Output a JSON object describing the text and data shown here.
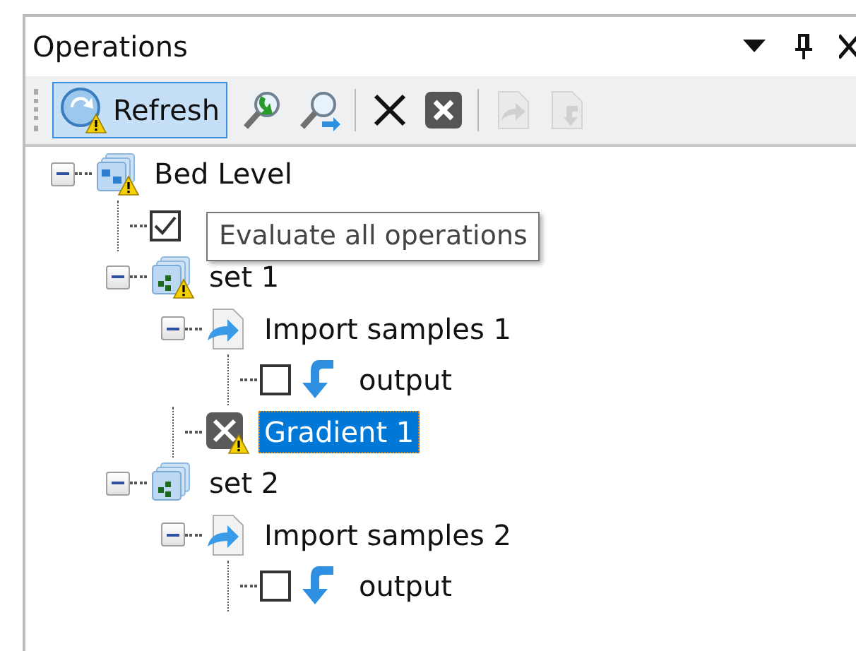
{
  "panel": {
    "title": "Operations"
  },
  "toolbar": [
    {
      "kind": "refresh",
      "label": "Refresh",
      "selected": true,
      "disabled": false
    },
    {
      "kind": "find-next",
      "disabled": false
    },
    {
      "kind": "find-prev",
      "disabled": false
    },
    {
      "kind": "separator"
    },
    {
      "kind": "delete",
      "disabled": false
    },
    {
      "kind": "cancel",
      "disabled": false
    },
    {
      "kind": "separator"
    },
    {
      "kind": "export",
      "disabled": true
    },
    {
      "kind": "import",
      "disabled": true
    }
  ],
  "tree": [
    {
      "kind": "group",
      "label": "Bed Level",
      "warning": true,
      "expanded": true,
      "selected": false,
      "children": [
        {
          "kind": "check",
          "checked": true
        },
        {
          "kind": "set",
          "label": "set 1",
          "warning": true,
          "expanded": true,
          "selected": false,
          "children": [
            {
              "kind": "import",
              "label": "Import samples 1",
              "warning": false,
              "expanded": true,
              "selected": false,
              "children": [
                {
                  "kind": "output",
                  "label": "output",
                  "checked": false,
                  "selected": false
                }
              ]
            },
            {
              "kind": "operation",
              "label": "Gradient 1",
              "warning": true,
              "selected": true
            }
          ]
        },
        {
          "kind": "set",
          "label": "set 2",
          "warning": false,
          "expanded": true,
          "selected": false,
          "children": [
            {
              "kind": "import",
              "label": "Import samples 2",
              "warning": false,
              "expanded": true,
              "selected": false,
              "children": [
                {
                  "kind": "output",
                  "label": "output",
                  "checked": false,
                  "selected": false
                }
              ]
            }
          ]
        }
      ]
    }
  ],
  "tooltip": {
    "text": "Evaluate all operations"
  }
}
